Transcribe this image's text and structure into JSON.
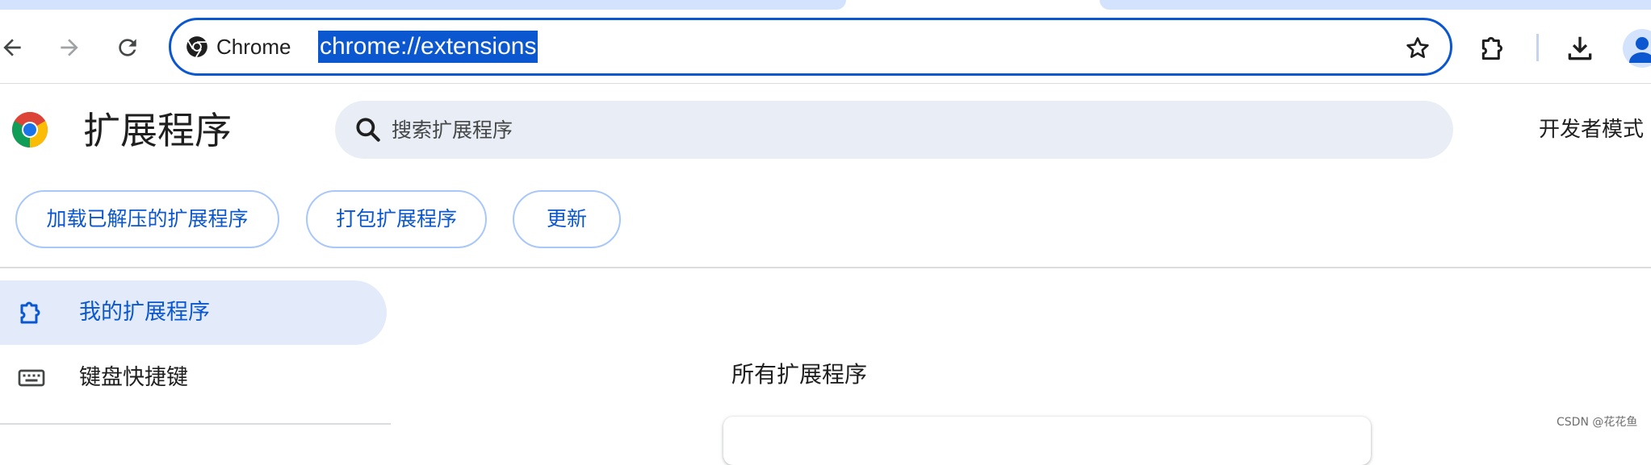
{
  "browser": {
    "chip_label": "Chrome",
    "url": "chrome://extensions",
    "icons": {
      "back": "arrow-back-icon",
      "forward": "arrow-forward-icon",
      "reload": "reload-icon",
      "bookmark": "star-icon",
      "extensions": "puzzle-icon",
      "downloads": "download-icon",
      "profile": "avatar-icon"
    }
  },
  "header": {
    "title": "扩展程序",
    "search_placeholder": "搜索扩展程序",
    "developer_mode_label": "开发者模式"
  },
  "actions": {
    "load_unpacked": "加载已解压的扩展程序",
    "pack": "打包扩展程序",
    "update": "更新"
  },
  "sidebar": {
    "items": [
      {
        "label": "我的扩展程序",
        "icon": "puzzle-icon",
        "active": true
      },
      {
        "label": "键盘快捷键",
        "icon": "keyboard-icon",
        "active": false
      }
    ]
  },
  "main": {
    "section_title": "所有扩展程序"
  },
  "watermark": "CSDN @花花鱼",
  "colors": {
    "accent": "#0b57d0",
    "selection": "#0b57d0",
    "search_bg": "#e9eef6",
    "active_item_bg": "#e3ebfb",
    "pill_border": "#a8c7fa"
  }
}
